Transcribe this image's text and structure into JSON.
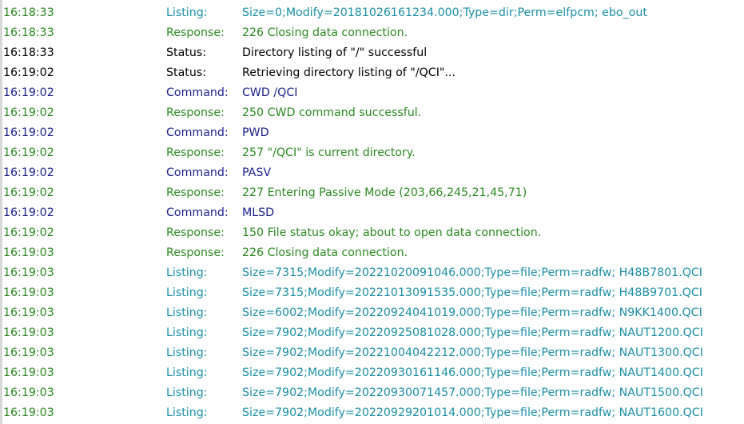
{
  "colors": {
    "listing": "#1b8fa6",
    "response": "#2a8a1f",
    "status": "#000000",
    "command": "#1a1f8c"
  },
  "log": [
    {
      "time": "16:18:33",
      "type": "Listing:",
      "kind": "listing",
      "message": "Size=0;Modify=20181026161234.000;Type=dir;Perm=elfpcm; ebo_out"
    },
    {
      "time": "16:18:33",
      "type": "Response:",
      "kind": "response",
      "message": "226 Closing data connection."
    },
    {
      "time": "16:18:33",
      "type": "Status:",
      "kind": "status",
      "message": "Directory listing of \"/\" successful"
    },
    {
      "time": "16:19:02",
      "type": "Status:",
      "kind": "status",
      "message": "Retrieving directory listing of \"/QCI\"..."
    },
    {
      "time": "16:19:02",
      "type": "Command:",
      "kind": "command",
      "message": "CWD /QCI"
    },
    {
      "time": "16:19:02",
      "type": "Response:",
      "kind": "response",
      "message": "250 CWD command successful."
    },
    {
      "time": "16:19:02",
      "type": "Command:",
      "kind": "command",
      "message": "PWD"
    },
    {
      "time": "16:19:02",
      "type": "Response:",
      "kind": "response",
      "message": "257 \"/QCI\" is current directory."
    },
    {
      "time": "16:19:02",
      "type": "Command:",
      "kind": "command",
      "message": "PASV"
    },
    {
      "time": "16:19:02",
      "type": "Response:",
      "kind": "response",
      "message": "227 Entering Passive Mode (203,66,245,21,45,71)"
    },
    {
      "time": "16:19:02",
      "type": "Command:",
      "kind": "command",
      "message": "MLSD"
    },
    {
      "time": "16:19:02",
      "type": "Response:",
      "kind": "response",
      "message": "150 File status okay; about to open data connection."
    },
    {
      "time": "16:19:03",
      "type": "Response:",
      "kind": "response",
      "message": "226 Closing data connection."
    },
    {
      "time": "16:19:03",
      "type": "Listing:",
      "kind": "listing",
      "message": "Size=7315;Modify=20221020091046.000;Type=file;Perm=radfw; H48B7801.QCI"
    },
    {
      "time": "16:19:03",
      "type": "Listing:",
      "kind": "listing",
      "message": "Size=7315;Modify=20221013091535.000;Type=file;Perm=radfw; H48B9701.QCI"
    },
    {
      "time": "16:19:03",
      "type": "Listing:",
      "kind": "listing",
      "message": "Size=6002;Modify=20220924041019.000;Type=file;Perm=radfw; N9KK1400.QCI"
    },
    {
      "time": "16:19:03",
      "type": "Listing:",
      "kind": "listing",
      "message": "Size=7902;Modify=20220925081028.000;Type=file;Perm=radfw; NAUT1200.QCI"
    },
    {
      "time": "16:19:03",
      "type": "Listing:",
      "kind": "listing",
      "message": "Size=7902;Modify=20221004042212.000;Type=file;Perm=radfw; NAUT1300.QCI"
    },
    {
      "time": "16:19:03",
      "type": "Listing:",
      "kind": "listing",
      "message": "Size=7902;Modify=20220930161146.000;Type=file;Perm=radfw; NAUT1400.QCI"
    },
    {
      "time": "16:19:03",
      "type": "Listing:",
      "kind": "listing",
      "message": "Size=7902;Modify=20220930071457.000;Type=file;Perm=radfw; NAUT1500.QCI"
    },
    {
      "time": "16:19:03",
      "type": "Listing:",
      "kind": "listing",
      "message": "Size=7902;Modify=20220929201014.000;Type=file;Perm=radfw; NAUT1600.QCI"
    }
  ]
}
